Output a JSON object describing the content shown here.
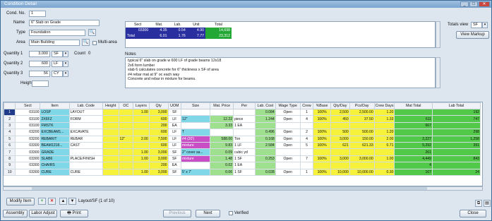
{
  "window": {
    "title": "Condition Detail",
    "controls": [
      "_",
      "□",
      "✕"
    ]
  },
  "form": {
    "cond_no_label": "Cond. No.",
    "cond_no": "1",
    "name_label": "Name",
    "name": "6\" Slab on Grade",
    "type_label": "Type",
    "type": "Foundation",
    "area_label": "Area",
    "area": "Main Building",
    "multi_area_label": "Multi-area",
    "q1_label": "Quantity 1",
    "q1": "3,000",
    "q1_unit": "SF",
    "count_label": "Count",
    "count": "0",
    "q2_label": "Quantity 2",
    "q2": "600",
    "q2_unit": "LF",
    "q3_label": "Quantity 3",
    "q3": "56",
    "q3_unit": "CY",
    "height_label": "Height",
    "height": ""
  },
  "summary": {
    "headers": [
      "Sect",
      "Mat.",
      "Lab.",
      "Unit",
      "Total"
    ],
    "rows": [
      [
        "03300",
        "4.35",
        "0.54",
        "4.90",
        "14,698"
      ],
      [
        "Total",
        "6.01",
        "1.76",
        "7.77",
        "23,312"
      ]
    ]
  },
  "totals_view": {
    "label": "Totals view",
    "value": "SF",
    "markup_button": "View Markup"
  },
  "notes": {
    "label": "Notes",
    "lines": [
      "typical 6\" slab on grade w 600 LF of grade beams 12x18",
      "2x6 form lumber",
      "slab 6 calculates concrete for 6\" thickness x SF of area",
      "#4 rebar mat at 9\" oc each way",
      "Concrete and rebar in mixture for beams."
    ]
  },
  "grid": {
    "headers": [
      "",
      "Sect",
      "Item",
      "Lab. Code",
      "Height",
      "OC",
      "Layers",
      "Qty",
      "UOM",
      "Size",
      "Mat. Price",
      "Per",
      "Lab. Cost",
      "Wage Type",
      "Crew",
      "%Base",
      "Qty/Day",
      "Pcs/Day",
      "Crew Days",
      "Mat Total",
      "Lab Total"
    ],
    "rows": [
      [
        "1",
        "03100",
        "LOSP",
        "LAYOUT",
        "",
        "",
        "1.00",
        "3,000",
        "SF",
        "",
        "",
        "",
        "0.084",
        "Open",
        "1",
        "100%",
        "2,500",
        "2,500.00",
        "1.20",
        "",
        "192"
      ],
      [
        "2",
        "03100",
        "2X6FZ",
        "FORM",
        "",
        "",
        "",
        "600",
        "LF",
        "12\"",
        "12.22",
        "piece",
        "1.244",
        "Open",
        "4",
        "100%",
        "450",
        "37.50",
        "1.33",
        "611",
        "747"
      ],
      [
        "3",
        "03100",
        "FMSTK",
        "",
        "",
        "",
        "",
        "200",
        "EA",
        "",
        "3.33",
        "1 EA",
        "",
        "",
        "",
        "",
        "",
        "",
        "",
        "667",
        ""
      ],
      [
        "4",
        "03200",
        "EXCBEAM1...",
        "EXCAVATE",
        "",
        "",
        "",
        "600",
        "LF",
        "T",
        "",
        "",
        "0.496",
        "Open",
        "2",
        "100%",
        "500",
        "500.00",
        "1.20",
        "",
        "298"
      ],
      [
        "5",
        "03200",
        "REBAR/T",
        "REBAR",
        "",
        "12\"",
        "2.00",
        "7,500",
        "LF",
        "#4 (20')",
        "588.00",
        "Ton",
        "0.168",
        "Open",
        "4",
        "100%",
        "3,000",
        "150.00",
        "2.00",
        "2,227",
        "1,258"
      ],
      [
        "6",
        "03300",
        "BEAM1218...",
        "CAST",
        "",
        "",
        "",
        "600",
        "LF",
        "mixture",
        "9.83",
        "1 LF",
        "2.584",
        "Open",
        "5",
        "100%",
        "621",
        "621.33",
        "0.71",
        "5,292",
        "391"
      ],
      [
        "7",
        "03300",
        "GRADE",
        "",
        "",
        "",
        "1.00",
        "3,000",
        "SF",
        "2\" cover sa...",
        "0.09",
        "cubic yd",
        "",
        "",
        "",
        "",
        "",
        "",
        "",
        "261",
        ""
      ],
      [
        "8",
        "03300",
        "SLAB6",
        "PLACE/FINISH",
        "",
        "",
        "1.00",
        "3,000",
        "SF",
        "mixture",
        "1.48",
        "1 SF",
        "0.253",
        "Open",
        "7",
        "100%",
        "3,000",
        "3,000.00",
        "1.00",
        "4,449",
        "843"
      ],
      [
        "9",
        "03300",
        "CHAIRS",
        "",
        "",
        "",
        "",
        "200",
        "EA",
        "",
        "0.02",
        "1 EA",
        "",
        "",
        "",
        "",
        "",
        "",
        "",
        "4",
        ""
      ],
      [
        "10",
        "03300",
        "CURE",
        "CURE",
        "",
        "",
        "1.00",
        "3,000",
        "SF",
        "5' x 7'",
        "0.06",
        "1 SF",
        "0.028",
        "Open",
        "1",
        "100%",
        "10,000",
        "10,000.00",
        "0.30",
        "167",
        "24"
      ]
    ]
  },
  "footer": {
    "modify_item": "Modify Item",
    "nav_text": "Layout/SF (1 of 10)",
    "assembly": "Assembly",
    "labor_adjust": "Labor Adjust",
    "print": "Print",
    "previous": "Previous",
    "next": "Next",
    "verified": "Verified",
    "close": "Close"
  }
}
